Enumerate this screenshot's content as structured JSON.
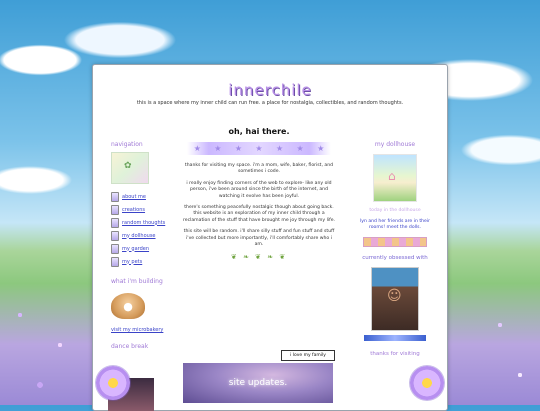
{
  "site": {
    "title": "innerchile",
    "tagline": "this is a space where my inner child can run free. a place for nostalgia, collectibles, and random thoughts."
  },
  "navigation": {
    "heading": "navigation",
    "items": [
      {
        "label": "about me"
      },
      {
        "label": "creations"
      },
      {
        "label": "random thoughts"
      },
      {
        "label": "my dollhouse"
      },
      {
        "label": "my garden"
      },
      {
        "label": "my pets"
      }
    ],
    "building_heading": "what i'm building",
    "microbakery_link": "visit my microbakery",
    "dance_heading": "dance break"
  },
  "main": {
    "greeting": "oh, hai there.",
    "paragraphs": [
      "thanks for visiting my space. i'm a mom, wife, baker, florist, and sometimes i code.",
      "i really enjoy finding corners of the web to explore- like any old person, i've been around since the birth of the internet, and watching it evolve has been joyful.",
      "there's something peacefully nostalgic though about going back. this website is an exploration of my inner child through a reclamation of the stuff that have brought me joy through my life.",
      "this site will be random. i'll share silly stuff and fun stuff and stuff i've collected but more importantly, i'll comfortably share who i am."
    ],
    "love_button": "i love my family",
    "updates_label": "site updates."
  },
  "right": {
    "dollhouse_heading": "my dollhouse",
    "today_label": "today in the dollhouse",
    "today_desc": "lyn and her friends are in their rooms! meet the dolls.",
    "obsessed_heading": "currently obsessed with",
    "thanks_heading": "thanks for visiting"
  },
  "colors": {
    "accent": "#a07ad6",
    "link": "#3a43c8"
  }
}
